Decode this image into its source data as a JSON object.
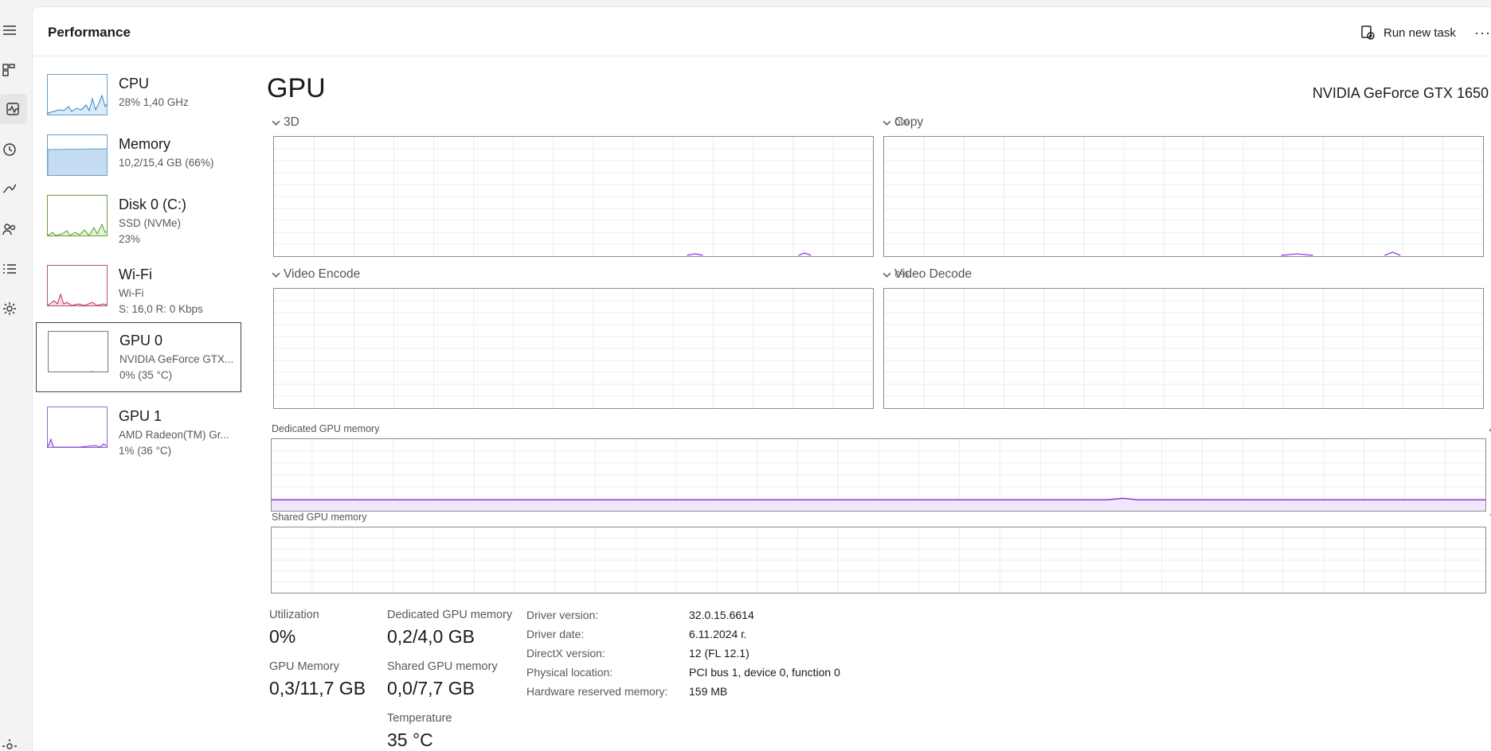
{
  "header": {
    "title": "Performance",
    "run_task_label": "Run new task",
    "more_label": "···"
  },
  "nav_icons": [
    "hamburger-icon",
    "processes-icon",
    "performance-icon",
    "app-history-icon",
    "startup-apps-icon",
    "users-icon",
    "details-icon",
    "services-icon",
    "settings-icon"
  ],
  "devices": [
    {
      "name": "CPU",
      "line1": "28%  1,40 GHz",
      "line2": ""
    },
    {
      "name": "Memory",
      "line1": "10,2/15,4 GB (66%)",
      "line2": ""
    },
    {
      "name": "Disk 0 (C:)",
      "line1": "SSD (NVMe)",
      "line2": "23%"
    },
    {
      "name": "Wi-Fi",
      "line1": "Wi-Fi",
      "line2": "S: 16,0  R: 0 Kbps"
    },
    {
      "name": "GPU 0",
      "line1": "NVIDIA GeForce GTX...",
      "line2": "0%  (35 °C)"
    },
    {
      "name": "GPU 1",
      "line1": "AMD Radeon(TM) Gr...",
      "line2": "1%  (36 °C)"
    }
  ],
  "gpu": {
    "title": "GPU",
    "model": "NVIDIA GeForce GTX 1650",
    "engines": [
      {
        "label": "3D",
        "pct": "0%"
      },
      {
        "label": "Copy",
        "pct": "0%"
      },
      {
        "label": "Video Encode",
        "pct": "0%"
      },
      {
        "label": "Video Decode",
        "pct": "0%"
      }
    ],
    "dedicated_label": "Dedicated GPU memory",
    "dedicated_max": "4,0 GB",
    "shared_label": "Shared GPU memory",
    "shared_max": "7,7 GB"
  },
  "stats": {
    "utilization_label": "Utilization",
    "utilization_value": "0%",
    "gpu_memory_label": "GPU Memory",
    "gpu_memory_value": "0,3/11,7 GB",
    "dedicated_label": "Dedicated GPU memory",
    "dedicated_value": "0,2/4,0 GB",
    "shared_label": "Shared GPU memory",
    "shared_value": "0,0/7,7 GB",
    "temperature_label": "Temperature",
    "temperature_value": "35 °C"
  },
  "info": [
    {
      "key": "Driver version:",
      "value": "32.0.15.6614"
    },
    {
      "key": "Driver date:",
      "value": "6.11.2024 г."
    },
    {
      "key": "DirectX version:",
      "value": "12 (FL 12.1)"
    },
    {
      "key": "Physical location:",
      "value": "PCI bus 1, device 0, function 0"
    },
    {
      "key": "Hardware reserved memory:",
      "value": "159 MB"
    }
  ],
  "colors": {
    "cpu": "#2f86c8",
    "memory": "#5b9bd5",
    "disk": "#5aa02c",
    "wifi": "#b5326e",
    "gpu": "#8a2be2",
    "grid": "#ececec"
  }
}
